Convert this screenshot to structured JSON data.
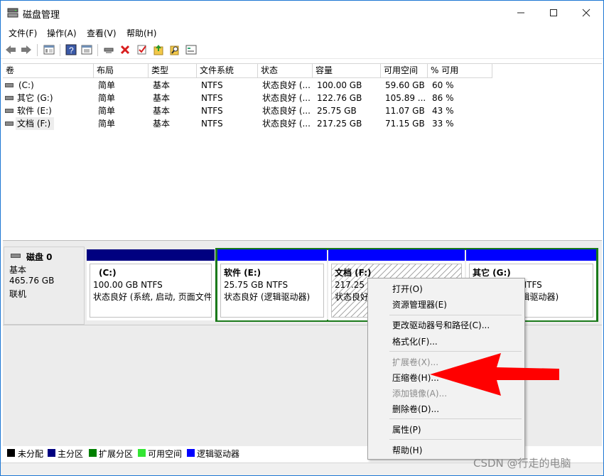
{
  "window": {
    "title": "磁盘管理",
    "minimize_glyph": "—",
    "maximize_glyph": "☐",
    "close_glyph": "✕"
  },
  "menu": [
    "文件(F)",
    "操作(A)",
    "查看(V)",
    "帮助(H)"
  ],
  "toolbar": {
    "icons": [
      "back-icon",
      "forward-icon",
      "properties-icon",
      "help-icon",
      "console-icon",
      "connect-icon",
      "delete-icon",
      "check-icon",
      "import-icon",
      "search-icon",
      "console2-icon"
    ],
    "delete_color": "#d81e1e"
  },
  "volume_list": {
    "columns": [
      "卷",
      "布局",
      "类型",
      "文件系统",
      "状态",
      "容量",
      "可用空间",
      "% 可用"
    ],
    "rows": [
      [
        "(C:)",
        "简单",
        "基本",
        "NTFS",
        "状态良好 (...",
        "100.00 GB",
        "59.60 GB",
        "60 %"
      ],
      [
        "其它 (G:)",
        "简单",
        "基本",
        "NTFS",
        "状态良好 (...",
        "122.76 GB",
        "105.89 ...",
        "86 %"
      ],
      [
        "软件 (E:)",
        "简单",
        "基本",
        "NTFS",
        "状态良好 (...",
        "25.75 GB",
        "11.07 GB",
        "43 %"
      ],
      [
        "文档 (F:)",
        "简单",
        "基本",
        "NTFS",
        "状态良好 (...",
        "217.25 GB",
        "71.15 GB",
        "33 %"
      ]
    ]
  },
  "disk": {
    "name": "磁盘 0",
    "type": "基本",
    "size": "465.76 GB",
    "status": "联机"
  },
  "partitions": [
    {
      "name": "(C:)",
      "size": "100.00 GB NTFS",
      "status": "状态良好 (系统, 启动, 页面文件"
    },
    {
      "name": "软件  (E:)",
      "size": "25.75 GB NTFS",
      "status": "状态良好 (逻辑驱动器)"
    },
    {
      "name": "文档  (F:)",
      "size": "217.25 GB NTFS",
      "status": "状态良好 (逻辑驱动器)"
    },
    {
      "name": "其它  (G:)",
      "size": "122.76 GB NTFS",
      "status": "状态良好 (逻辑驱动器)"
    }
  ],
  "colors": {
    "primary_partition": "#000080",
    "logical_drive": "#0000ff",
    "extended_partition": "#008000",
    "free_space": "#33e533",
    "unallocated": "#000000",
    "arrow": "#ff0000"
  },
  "legend": [
    "未分配",
    "主分区",
    "扩展分区",
    "可用空间",
    "逻辑驱动器"
  ],
  "context_menu": {
    "items": [
      {
        "label": "打开(O)",
        "enabled": true
      },
      {
        "label": "资源管理器(E)",
        "enabled": true
      },
      {
        "label": "更改驱动器号和路径(C)...",
        "enabled": true
      },
      {
        "label": "格式化(F)...",
        "enabled": true
      },
      {
        "label": "扩展卷(X)...",
        "enabled": false
      },
      {
        "label": "压缩卷(H)...",
        "enabled": true
      },
      {
        "label": "添加镜像(A)...",
        "enabled": false
      },
      {
        "label": "删除卷(D)...",
        "enabled": true
      },
      {
        "label": "属性(P)",
        "enabled": true
      },
      {
        "label": "帮助(H)",
        "enabled": true
      }
    ]
  },
  "watermark": "CSDN @行走的电脑"
}
